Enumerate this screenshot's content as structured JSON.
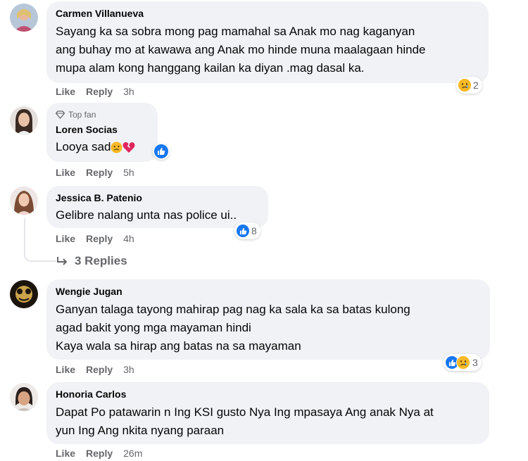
{
  "comments": [
    {
      "name": "Carmen Villanueva",
      "lines": [
        "Sayang ka sa sobra mong pag mamahal sa Anak mo nag kaganyan",
        "ang buhay mo at kawawa ang Anak mo hinde muna maalagaan hinde",
        "mupa alam kong hanggang kailan ka diyan .mag dasal ka."
      ],
      "like": "Like",
      "reply": "Reply",
      "time": "3h",
      "reaction_count": "2"
    },
    {
      "badge": "Top fan",
      "name": "Loren Socias",
      "text": "Looya sad",
      "like": "Like",
      "reply": "Reply",
      "time": "5h"
    },
    {
      "name": "Jessica B. Patenio",
      "text": "Gelibre nalang unta nas police ui..",
      "like": "Like",
      "reply": "Reply",
      "time": "4h",
      "reaction_count": "8"
    },
    {
      "name": "Wengie Jugan",
      "lines": [
        "Ganyan talaga tayong mahirap pag nag ka sala ka sa batas kulong",
        "agad bakit yong mga mayaman hindi",
        "Kaya wala sa hirap ang batas na sa mayaman"
      ],
      "like": "Like",
      "reply": "Reply",
      "time": "3h",
      "reaction_count": "3"
    },
    {
      "name": "Honoria Carlos",
      "lines": [
        "Dapat Po patawarin n Ing KSI gusto Nya Ing mpasaya Ang anak Nya at",
        "yun Ing Ang nkita nyang paraan"
      ],
      "like": "Like",
      "reply": "Reply",
      "time": "26m"
    }
  ],
  "replies_link": "3 Replies",
  "colors": {
    "bubble": "#f0f2f5",
    "meta": "#65676b",
    "like_blue": "#1877f2",
    "sad_yellow": "#f7b928"
  }
}
